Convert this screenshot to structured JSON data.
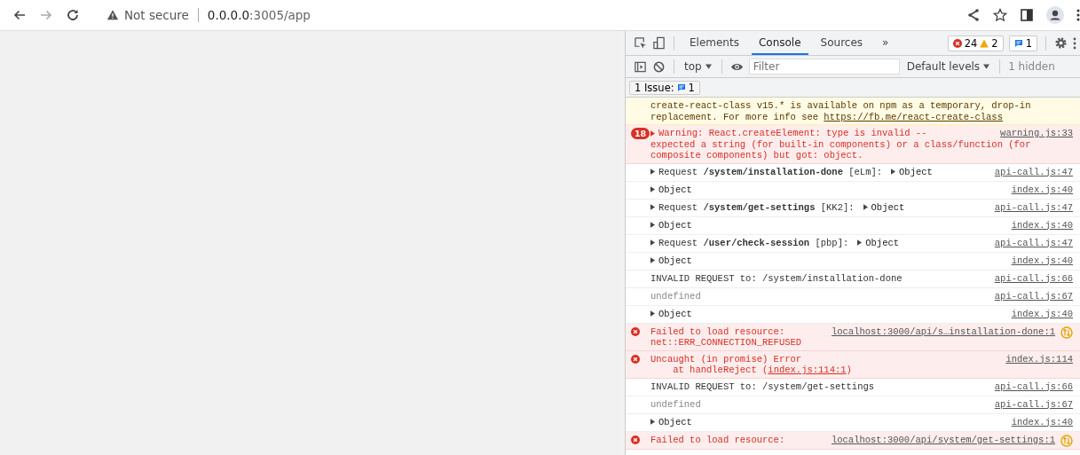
{
  "browser": {
    "security": "Not secure",
    "host": "0.0.0.0",
    "path": ":3005/app"
  },
  "devtools": {
    "tabs": [
      {
        "label": "Elements",
        "selected": false
      },
      {
        "label": "Console",
        "selected": true
      },
      {
        "label": "Sources",
        "selected": false
      }
    ],
    "more": "»",
    "errors": "24",
    "warnings": "2",
    "infos": "1",
    "context": "top",
    "filter_placeholder": "Filter",
    "levels": "Default levels",
    "hidden": "1 hidden",
    "issues_label": "1 Issue:",
    "issues_count": "1"
  },
  "messages": [
    {
      "kind": "warning",
      "lines": [
        {
          "text": "create-react-class v15.* is available on npm as a temporary, drop-in"
        },
        {
          "text": "replacement. For more info see ",
          "link": "https://fb.me/react-create-class"
        }
      ]
    },
    {
      "kind": "error",
      "count": "18",
      "expandable": true,
      "network": false,
      "lines": [
        {
          "text": "Warning: React.createElement: type is invalid --"
        },
        {
          "text": "expected a string (for built-in components) or a class/function (for"
        },
        {
          "text": "composite components) but got: object."
        }
      ],
      "source": "warning.js:33"
    },
    {
      "kind": "log",
      "expandable": true,
      "lines": [
        {
          "text": "Request **/system/installation-done** [eLm]:"
        }
      ],
      "object": "Object",
      "source": "api-call.js:47"
    },
    {
      "kind": "log",
      "expandable": false,
      "object": "Object",
      "source": "index.js:40"
    },
    {
      "kind": "log",
      "expandable": true,
      "lines": [
        {
          "text": "Request **/system/get-settings** [KK2]:"
        }
      ],
      "object": "Object",
      "source": "api-call.js:47"
    },
    {
      "kind": "log",
      "expandable": false,
      "object": "Object",
      "source": "index.js:40"
    },
    {
      "kind": "log",
      "expandable": true,
      "lines": [
        {
          "text": "Request **/user/check-session** [pbp]:"
        }
      ],
      "object": "Object",
      "source": "api-call.js:47"
    },
    {
      "kind": "log",
      "expandable": false,
      "object": "Object",
      "source": "index.js:40"
    },
    {
      "kind": "log",
      "expandable": false,
      "lines": [
        {
          "text": "INVALID REQUEST to: /system/installation-done"
        }
      ],
      "source": "api-call.js:66"
    },
    {
      "kind": "muted",
      "expandable": false,
      "lines": [
        {
          "text": "undefined"
        }
      ],
      "source": "api-call.js:67"
    },
    {
      "kind": "log",
      "expandable": false,
      "object": "Object",
      "source": "index.js:40"
    },
    {
      "kind": "error",
      "expandable": false,
      "network": true,
      "lines": [
        {
          "text": "Failed to load resource:"
        },
        {
          "text": "net::ERR_CONNECTION_REFUSED"
        }
      ],
      "source": "localhost:3000/api/s…installation-done:1"
    },
    {
      "kind": "error",
      "expandable": false,
      "network": false,
      "lines": [
        {
          "text": "Uncaught (in promise) Error"
        },
        {
          "text": "    at handleReject (",
          "link": "index.js:114:1",
          "after": ")"
        }
      ],
      "source": "index.js:114"
    },
    {
      "kind": "log",
      "expandable": false,
      "lines": [
        {
          "text": "INVALID REQUEST to: /system/get-settings"
        }
      ],
      "source": "api-call.js:66"
    },
    {
      "kind": "muted",
      "expandable": false,
      "lines": [
        {
          "text": "undefined"
        }
      ],
      "source": "api-call.js:67"
    },
    {
      "kind": "log",
      "expandable": false,
      "object": "Object",
      "source": "index.js:40"
    },
    {
      "kind": "error",
      "expandable": false,
      "network": true,
      "lines": [
        {
          "text": "Failed to load resource:"
        }
      ],
      "source": "localhost:3000/api/system/get-settings:1"
    }
  ]
}
